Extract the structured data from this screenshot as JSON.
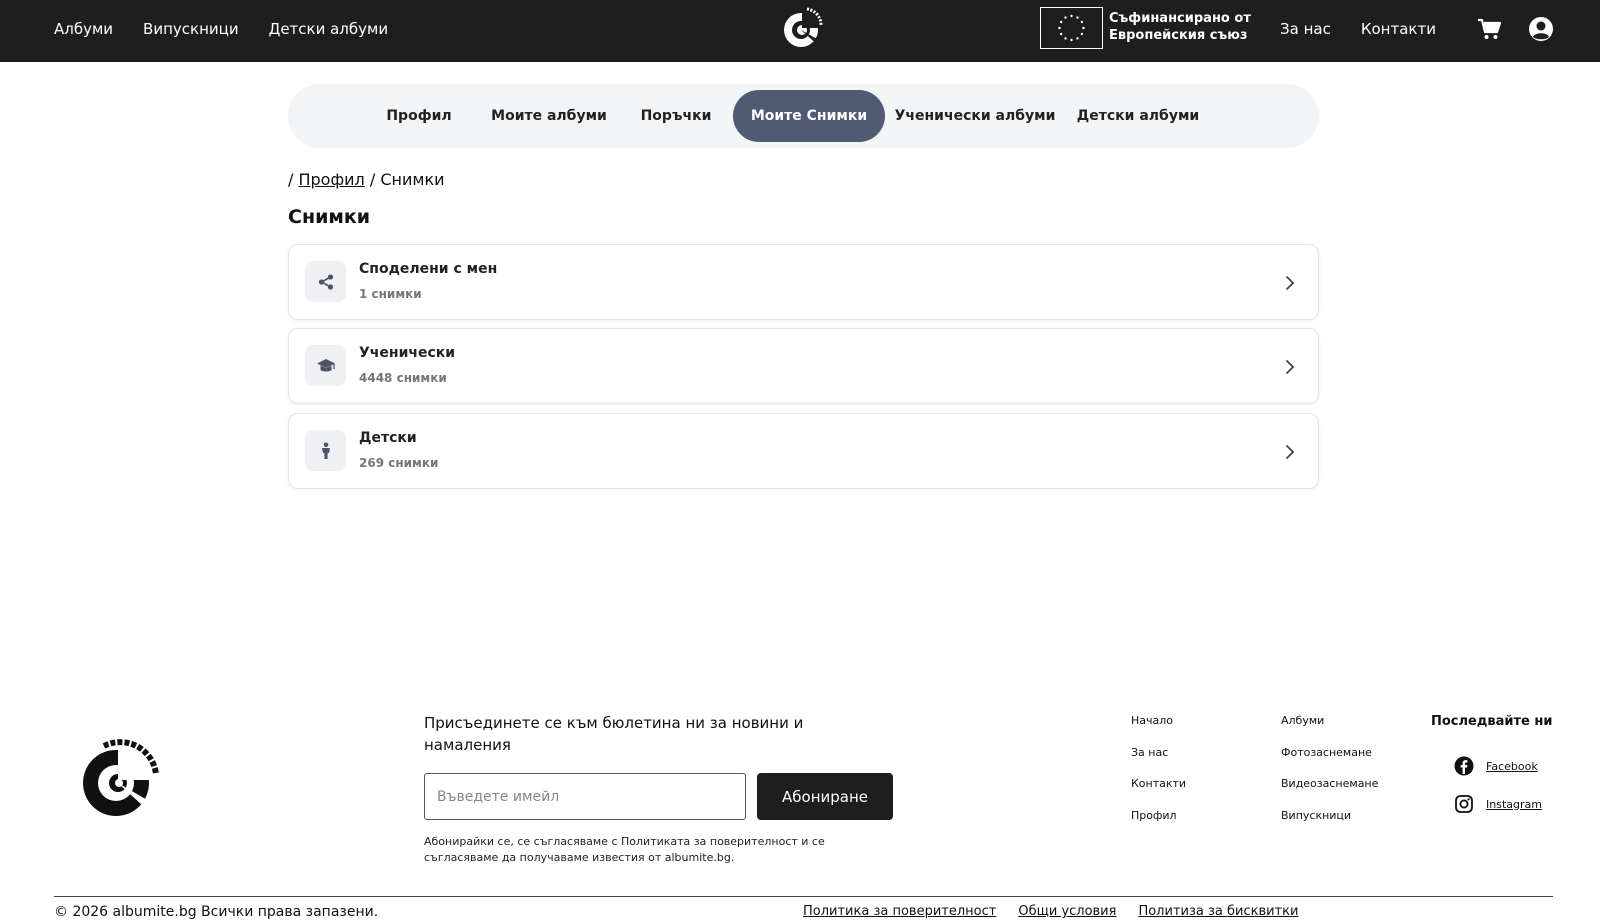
{
  "header": {
    "nav_left": [
      "Албуми",
      "Випускници",
      "Детски албуми"
    ],
    "logo_text": "ALBUMITE.BG",
    "eu_text_line1": "Съфинансирано от",
    "eu_text_line2": "Европейския съюз",
    "nav_right": [
      "За нас",
      "Контакти"
    ],
    "cart_icon": "cart-icon",
    "user_icon": "user-icon"
  },
  "tabs": [
    {
      "label": "Профил",
      "active": false
    },
    {
      "label": "Моите албуми",
      "active": false
    },
    {
      "label": "Поръчки",
      "active": false
    },
    {
      "label": "Моите Снимки",
      "active": true
    },
    {
      "label": "Ученически албуми",
      "active": false
    },
    {
      "label": "Детски албуми",
      "active": false
    }
  ],
  "breadcrumb": {
    "separator": "/",
    "link": "Профил",
    "current": "Снимки"
  },
  "page_title": "Снимки",
  "cards": [
    {
      "title": "Споделени с мен",
      "count": "1 снимки",
      "icon": "share-icon"
    },
    {
      "title": "Ученически",
      "count": "4448 снимки",
      "icon": "graduation-cap-icon"
    },
    {
      "title": "Детски",
      "count": "269 снимки",
      "icon": "child-icon"
    }
  ],
  "footer": {
    "newsletter_text": "Присъединете се към бюлетина ни за новини и намаления",
    "email_placeholder": "Въведете имейл",
    "subscribe_label": "Абониране",
    "consent_text": "Абонирайки се, се съгласяваме с Политиката за поверителност и се съгласяваме да получаваме известия от albumite.bg.",
    "col1": [
      "Начало",
      "За нас",
      "Контакти",
      "Профил"
    ],
    "col2": [
      "Албуми",
      "Фотозаснемане",
      "Видеозаснемане",
      "Випускници"
    ],
    "follow_title": "Последвайте ни",
    "social": [
      {
        "label": "Facebook",
        "icon": "facebook-icon"
      },
      {
        "label": "Instagram",
        "icon": "instagram-icon"
      }
    ],
    "copyright": "© 2026 albumite.bg Всички права запазени.",
    "legal": [
      "Политика за поверителност",
      "Общи условия",
      "Политиза за бисквитки"
    ]
  }
}
